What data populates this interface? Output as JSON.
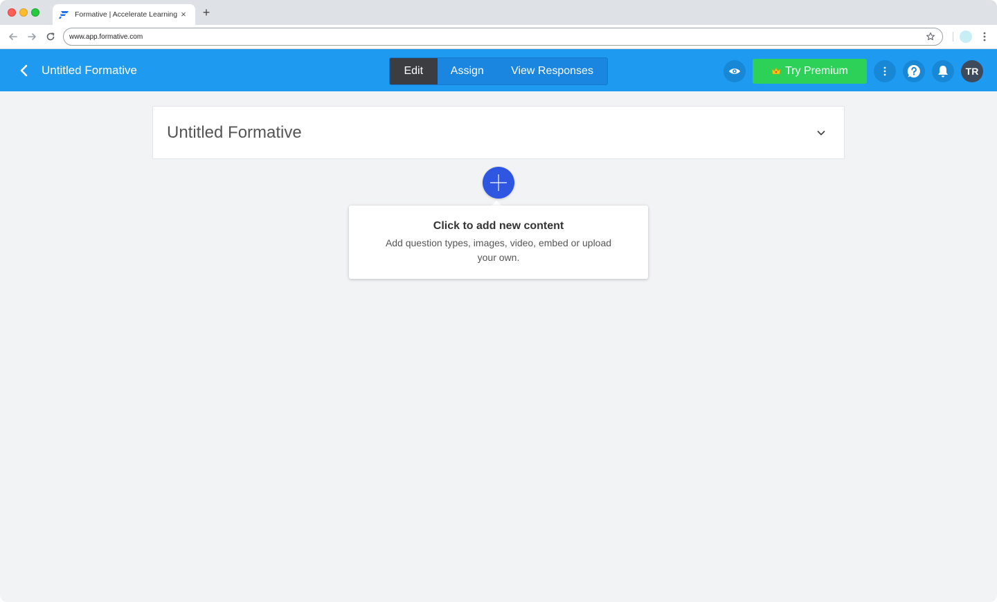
{
  "browser": {
    "tab_title": "Formative | Accelerate Learning",
    "tab_close": "×",
    "new_tab": "+",
    "url": "www.app.formative.com"
  },
  "header": {
    "title": "Untitled Formative",
    "tabs": [
      {
        "label": "Edit",
        "active": true
      },
      {
        "label": "Assign",
        "active": false
      },
      {
        "label": "View Responses",
        "active": false
      }
    ],
    "premium_label": "Try Premium",
    "avatar_initials": "TR",
    "colors": {
      "bar": "#1e9bf0",
      "active_tab": "#3b3d41",
      "premium": "#2ed158",
      "add_button": "#2f56e0"
    }
  },
  "content": {
    "formative_title": "Untitled Formative",
    "add_tooltip": {
      "heading": "Click to add new content",
      "body": "Add question types, images, video, embed or upload your own."
    }
  },
  "icons": [
    "back-arrow-icon",
    "forward-arrow-icon",
    "reload-icon",
    "star-icon",
    "chrome-menu-icon",
    "chevron-left-icon",
    "eye-icon",
    "crown-icon",
    "more-vertical-icon",
    "help-icon",
    "bell-icon",
    "chevron-down-icon",
    "plus-icon"
  ]
}
